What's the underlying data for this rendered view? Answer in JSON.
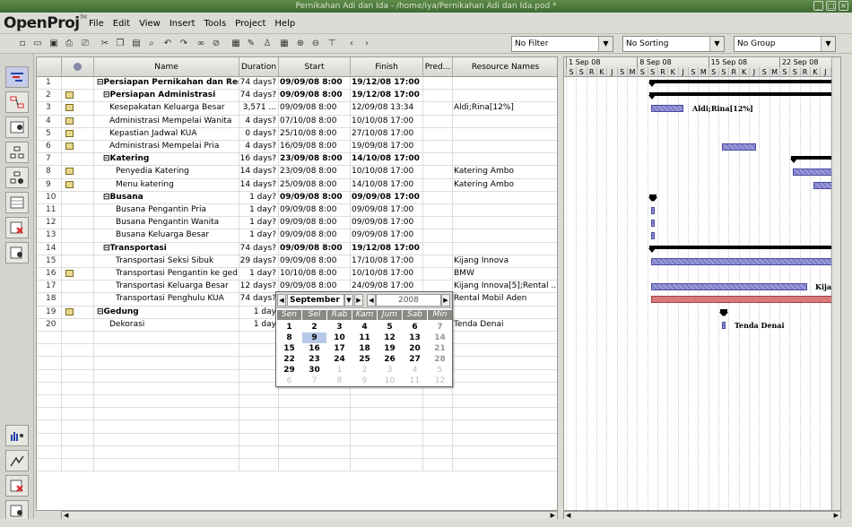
{
  "window_title": "Pernikahan Adi dan Ida - /home/iya/Pernikahan Adi dan Ida.pod *",
  "logo": {
    "text": "OpenProj",
    "tm": "TM"
  },
  "menu": [
    "File",
    "Edit",
    "View",
    "Insert",
    "Tools",
    "Project",
    "Help"
  ],
  "filters": {
    "filter": "No Filter",
    "sorting": "No Sorting",
    "group": "No Group"
  },
  "columns": [
    "Name",
    "Duration",
    "Start",
    "Finish",
    "Pred...",
    "Resource Names"
  ],
  "rows": [
    {
      "id": "1",
      "name": "⊟Persiapan Pernikahan dan Resep",
      "dur": "74 days?",
      "start": "09/09/08 8:00",
      "finish": "19/12/08 17:00",
      "res": "",
      "bold": true,
      "indent": 0,
      "note": false
    },
    {
      "id": "2",
      "name": "⊟Persiapan Administrasi",
      "dur": "74 days?",
      "start": "09/09/08 8:00",
      "finish": "19/12/08 17:00",
      "res": "",
      "bold": true,
      "indent": 1,
      "note": true
    },
    {
      "id": "3",
      "name": "Kesepakatan Keluarga Besar",
      "dur": "3,571 ...",
      "start": "09/09/08 8:00",
      "finish": "12/09/08 13:34",
      "res": "Aldi;Rina[12%]",
      "bold": false,
      "indent": 2,
      "note": true
    },
    {
      "id": "4",
      "name": "Administrasi Mempelai Wanita",
      "dur": "4 days?",
      "start": "07/10/08 8:00",
      "finish": "10/10/08 17:00",
      "res": "",
      "bold": false,
      "indent": 2,
      "note": true
    },
    {
      "id": "5",
      "name": "Kepastian Jadwal KUA",
      "dur": "0 days?",
      "start": "25/10/08 8:00",
      "finish": "27/10/08 17:00",
      "res": "",
      "bold": false,
      "indent": 2,
      "note": true
    },
    {
      "id": "6",
      "name": "Administrasi Mempelai Pria",
      "dur": "4 days?",
      "start": "16/09/08 8:00",
      "finish": "19/09/08 17:00",
      "res": "",
      "bold": false,
      "indent": 2,
      "note": true
    },
    {
      "id": "7",
      "name": "⊟Katering",
      "dur": "16 days?",
      "start": "23/09/08 8:00",
      "finish": "14/10/08 17:00",
      "res": "",
      "bold": true,
      "indent": 1,
      "note": false
    },
    {
      "id": "8",
      "name": "Penyedia Katering",
      "dur": "14 days?",
      "start": "23/09/08 8:00",
      "finish": "10/10/08 17:00",
      "res": "Katering Ambo",
      "bold": false,
      "indent": 3,
      "note": true
    },
    {
      "id": "9",
      "name": "Menu katering",
      "dur": "14 days?",
      "start": "25/09/08 8:00",
      "finish": "14/10/08 17:00",
      "res": "Katering Ambo",
      "bold": false,
      "indent": 3,
      "note": true
    },
    {
      "id": "10",
      "name": "⊟Busana",
      "dur": "1 day?",
      "start": "09/09/08 8:00",
      "finish": "09/09/08 17:00",
      "res": "",
      "bold": true,
      "indent": 1,
      "note": false
    },
    {
      "id": "11",
      "name": "Busana Pengantin Pria",
      "dur": "1 day?",
      "start": "09/09/08 8:00",
      "finish": "09/09/08 17:00",
      "res": "",
      "bold": false,
      "indent": 3,
      "note": false
    },
    {
      "id": "12",
      "name": "Busana Pengantin Wanita",
      "dur": "1 day?",
      "start": "09/09/08 8:00",
      "finish": "09/09/08 17:00",
      "res": "",
      "bold": false,
      "indent": 3,
      "note": false
    },
    {
      "id": "13",
      "name": "Busana Keluarga Besar",
      "dur": "1 day?",
      "start": "09/09/08 8:00",
      "finish": "09/09/08 17:00",
      "res": "",
      "bold": false,
      "indent": 3,
      "note": false
    },
    {
      "id": "14",
      "name": "⊟Transportasi",
      "dur": "74 days?",
      "start": "09/09/08 8:00",
      "finish": "19/12/08 17:00",
      "res": "",
      "bold": true,
      "indent": 1,
      "note": false
    },
    {
      "id": "15",
      "name": "Transportasi Seksi Sibuk",
      "dur": "29 days?",
      "start": "09/09/08 8:00",
      "finish": "17/10/08 17:00",
      "res": "Kijang Innova",
      "bold": false,
      "indent": 3,
      "note": false
    },
    {
      "id": "16",
      "name": "Transportasi Pengantin ke ged",
      "dur": "1 day?",
      "start": "10/10/08 8:00",
      "finish": "10/10/08 17:00",
      "res": "BMW",
      "bold": false,
      "indent": 3,
      "note": true
    },
    {
      "id": "17",
      "name": "Transportasi Keluarga Besar",
      "dur": "12 days?",
      "start": "09/09/08 8:00",
      "finish": "24/09/08 17:00",
      "res": "Kijang Innova[5];Rental ...",
      "bold": false,
      "indent": 3,
      "note": false
    },
    {
      "id": "18",
      "name": "Transportasi Penghulu KUA",
      "dur": "74 days?",
      "start": "",
      "finish": "",
      "res": "Rental Mobil Aden",
      "bold": false,
      "indent": 3,
      "note": false
    },
    {
      "id": "19",
      "name": "⊟Gedung",
      "dur": "1 day",
      "start": "",
      "finish": "",
      "res": "",
      "bold": true,
      "indent": 0,
      "note": true
    },
    {
      "id": "20",
      "name": "Dekorasi",
      "dur": "1 day",
      "start": "",
      "finish": "",
      "res": "Tenda Denai",
      "bold": false,
      "indent": 2,
      "note": false
    }
  ],
  "gantt": {
    "weeks": [
      "1 Sep 08",
      "8 Sep 08",
      "15 Sep 08",
      "22 Sep 08"
    ],
    "days": [
      "S",
      "S",
      "R",
      "K",
      "J",
      "S",
      "M",
      "S",
      "S",
      "R",
      "K",
      "J",
      "S",
      "M",
      "S",
      "S",
      "R",
      "K",
      "J",
      "S",
      "M",
      "S",
      "S",
      "R",
      "K",
      "J",
      "S"
    ],
    "labels": {
      "r3": "Aldi;Rina[12%]",
      "r17": "Kijang",
      "r20": "Tenda Denai"
    }
  },
  "calendar": {
    "month": "September",
    "year": "2008",
    "daynames": [
      "Sen",
      "Sel",
      "Rab",
      "Kam",
      "Jum",
      "Sab",
      "Min"
    ],
    "weeks": [
      [
        "1",
        "2",
        "3",
        "4",
        "5",
        "6",
        "7"
      ],
      [
        "8",
        "9",
        "10",
        "11",
        "12",
        "13",
        "14"
      ],
      [
        "15",
        "16",
        "17",
        "18",
        "19",
        "20",
        "21"
      ],
      [
        "22",
        "23",
        "24",
        "25",
        "26",
        "27",
        "28"
      ],
      [
        "29",
        "30",
        "1",
        "2",
        "3",
        "4",
        "5"
      ],
      [
        "6",
        "7",
        "8",
        "9",
        "10",
        "11",
        "12"
      ]
    ],
    "selected": "9"
  }
}
